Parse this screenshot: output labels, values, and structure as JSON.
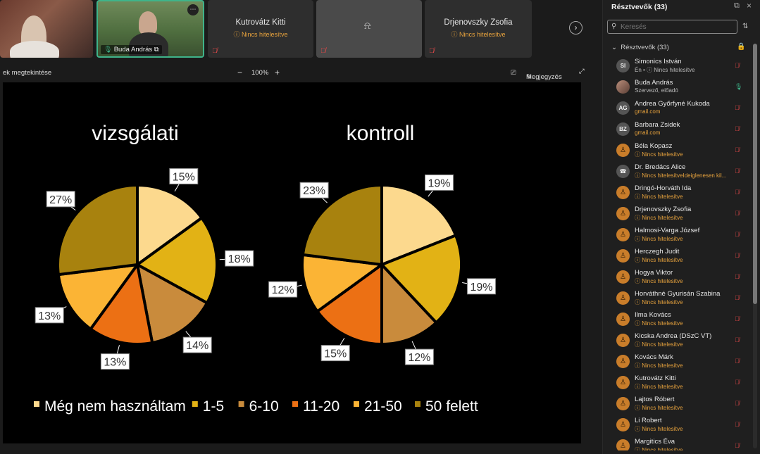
{
  "strip": {
    "tiles": [
      {
        "name": "",
        "status": ""
      },
      {
        "name": "Buda András",
        "status": ""
      },
      {
        "name": "Kutrovátz Kitti",
        "status": "ⓘ Nincs hitelesítve"
      },
      {
        "name": "",
        "status": ""
      },
      {
        "name": "Drjenovszky Zsofia",
        "status": "ⓘ Nincs hitelesítve"
      }
    ],
    "more_icon": "⋯",
    "next_icon": "›"
  },
  "toolbar": {
    "view_label": "ek megtekintése",
    "zoom_out": "−",
    "zoom": "100%",
    "zoom_in": "+",
    "note_label": "Megjegyzés",
    "expand_icon": "⤢"
  },
  "slide": {
    "left_title": "vizsgálati",
    "right_title": "kontroll",
    "legend": [
      {
        "label": "Még nem használtam",
        "color": "#FCD98E"
      },
      {
        "label": "1-5",
        "color": "#E2B215"
      },
      {
        "label": "6-10",
        "color": "#C98B3C"
      },
      {
        "label": "11-20",
        "color": "#EC7014"
      },
      {
        "label": "21-50",
        "color": "#FBB435"
      },
      {
        "label": "50 felett",
        "color": "#A8820E"
      }
    ]
  },
  "chart_data": [
    {
      "type": "pie",
      "title": "vizsgálati",
      "categories": [
        "Még nem használtam",
        "1-5",
        "6-10",
        "11-20",
        "21-50",
        "50 felett"
      ],
      "values": [
        15,
        18,
        14,
        13,
        13,
        27
      ],
      "labels": [
        "15%",
        "18%",
        "14%",
        "13%",
        "13%",
        "27%"
      ],
      "colors": [
        "#FCD98E",
        "#E2B215",
        "#C98B3C",
        "#EC7014",
        "#FBB435",
        "#A8820E"
      ]
    },
    {
      "type": "pie",
      "title": "kontroll",
      "categories": [
        "Még nem használtam",
        "1-5",
        "6-10",
        "11-20",
        "21-50",
        "50 felett"
      ],
      "values": [
        19,
        19,
        12,
        15,
        12,
        23
      ],
      "labels": [
        "19%",
        "19%",
        "12%",
        "15%",
        "12%",
        "23%"
      ],
      "colors": [
        "#FCD98E",
        "#E2B215",
        "#C98B3C",
        "#EC7014",
        "#FBB435",
        "#A8820E"
      ]
    }
  ],
  "sidebar": {
    "title": "Résztvevők (33)",
    "search_placeholder": "Keresés",
    "section_label": "Résztvevők (33)",
    "participants": [
      {
        "name": "Simonics István",
        "sub": "Én • ⓘ Nincs hitelesítve",
        "avatar": "SI",
        "kind": "ini",
        "subclass": "grey"
      },
      {
        "name": "Buda András",
        "sub": "Szervező, előadó",
        "avatar": "",
        "kind": "pic",
        "subclass": "grey"
      },
      {
        "name": "Andrea Győrfyné Kukoda",
        "sub": "gmail.com",
        "avatar": "AG",
        "kind": "ini",
        "subclass": "gmail"
      },
      {
        "name": "Barbara Zsidek",
        "sub": "gmail.com",
        "avatar": "BZ",
        "kind": "ini",
        "subclass": "gmail"
      },
      {
        "name": "Béla Kopasz",
        "sub": "ⓘ Nincs hitelesítve",
        "avatar": "♙",
        "kind": "guest",
        "subclass": "warn"
      },
      {
        "name": "Dr. Bredács Alice",
        "sub": "ⓘ Nincs hitelesítveIdeiglenesen kil...",
        "avatar": "☎",
        "kind": "ini",
        "subclass": "warn"
      },
      {
        "name": "Dringó-Horváth Ida",
        "sub": "ⓘ Nincs hitelesítve",
        "avatar": "♙",
        "kind": "guest",
        "subclass": "warn"
      },
      {
        "name": "Drjenovszky Zsofia",
        "sub": "ⓘ Nincs hitelesítve",
        "avatar": "♙",
        "kind": "guest",
        "subclass": "warn"
      },
      {
        "name": "Halmosi-Varga József",
        "sub": "ⓘ Nincs hitelesítve",
        "avatar": "♙",
        "kind": "guest",
        "subclass": "warn"
      },
      {
        "name": "Herczegh Judit",
        "sub": "ⓘ Nincs hitelesítve",
        "avatar": "♙",
        "kind": "guest",
        "subclass": "warn"
      },
      {
        "name": "Hogya Viktor",
        "sub": "ⓘ Nincs hitelesítve",
        "avatar": "♙",
        "kind": "guest",
        "subclass": "warn"
      },
      {
        "name": "Horváthné Gyurisán Szabina",
        "sub": "ⓘ Nincs hitelesítve",
        "avatar": "♙",
        "kind": "guest",
        "subclass": "warn"
      },
      {
        "name": "Ilma Kovács",
        "sub": "ⓘ Nincs hitelesítve",
        "avatar": "♙",
        "kind": "guest",
        "subclass": "warn"
      },
      {
        "name": "Kicska Andrea (DSzC VT)",
        "sub": "ⓘ Nincs hitelesítve",
        "avatar": "♙",
        "kind": "guest",
        "subclass": "warn"
      },
      {
        "name": "Kovács Márk",
        "sub": "ⓘ Nincs hitelesítve",
        "avatar": "♙",
        "kind": "guest",
        "subclass": "warn"
      },
      {
        "name": "Kutrovátz Kitti",
        "sub": "ⓘ Nincs hitelesítve",
        "avatar": "♙",
        "kind": "guest",
        "subclass": "warn"
      },
      {
        "name": "Lajtos Róbert",
        "sub": "ⓘ Nincs hitelesítve",
        "avatar": "♙",
        "kind": "guest",
        "subclass": "warn"
      },
      {
        "name": "Li Robert",
        "sub": "ⓘ Nincs hitelesítve",
        "avatar": "♙",
        "kind": "guest",
        "subclass": "warn"
      },
      {
        "name": "Margitics Éva",
        "sub": "ⓘ Nincs hitelesítve",
        "avatar": "♙",
        "kind": "guest",
        "subclass": "warn"
      }
    ]
  }
}
